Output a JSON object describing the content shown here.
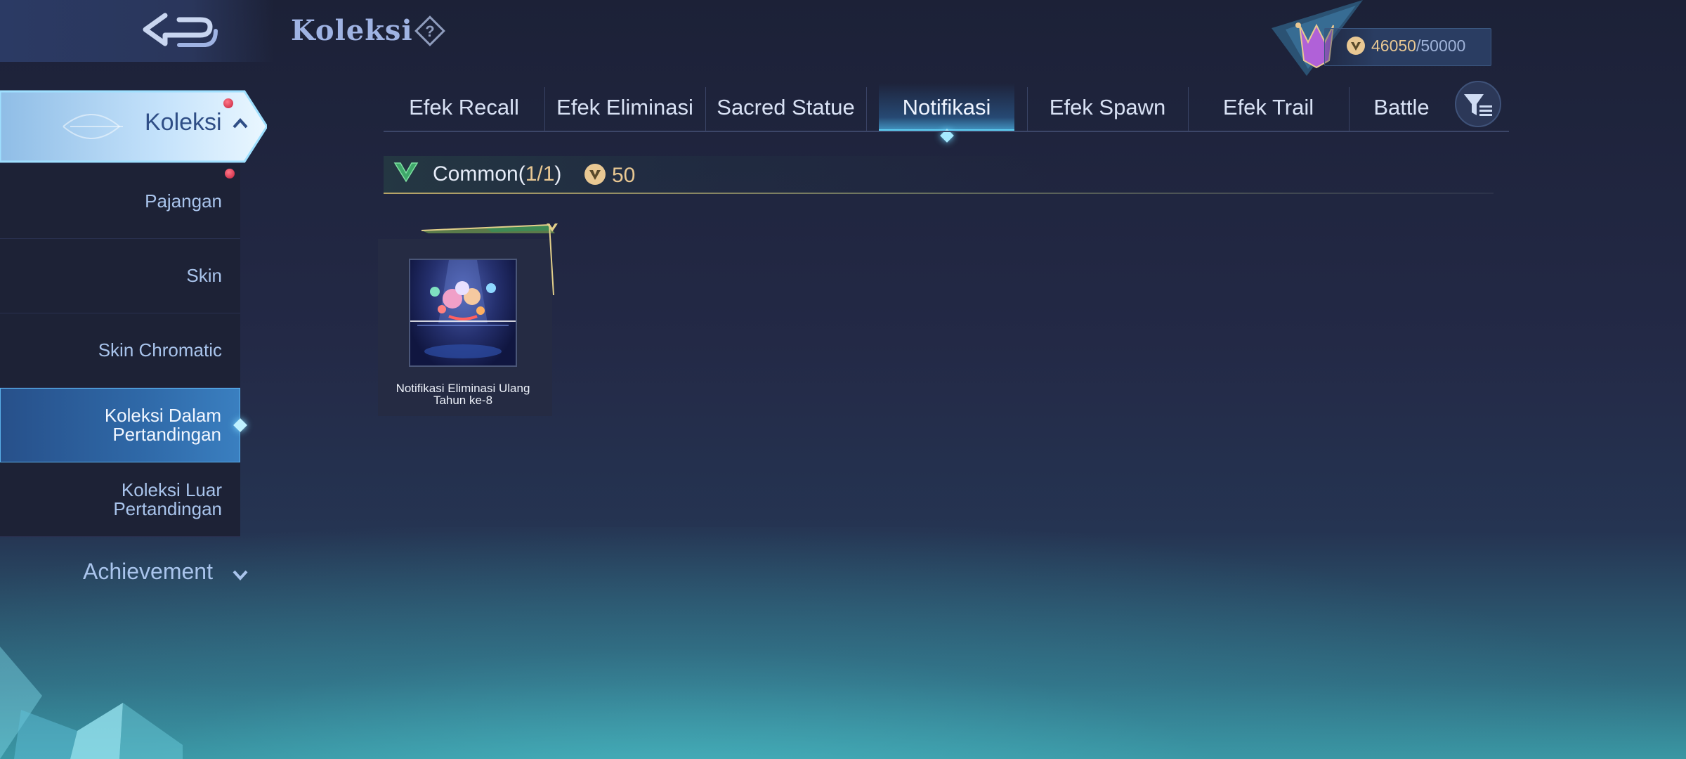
{
  "header": {
    "title": "Koleksi"
  },
  "points": {
    "current": "46050",
    "separator": "/",
    "max": "50000"
  },
  "sidebar": {
    "main_label": "Koleksi",
    "items": [
      {
        "label": "Pajangan"
      },
      {
        "label": "Skin"
      },
      {
        "label": "Skin Chromatic"
      },
      {
        "label": "Koleksi Dalam Pertandingan"
      },
      {
        "label": "Koleksi Luar Pertandingan"
      }
    ],
    "achievement_label": "Achievement"
  },
  "tabs": [
    {
      "label": "Efek Recall"
    },
    {
      "label": "Efek Eliminasi"
    },
    {
      "label": "Sacred Statue"
    },
    {
      "label": "Notifikasi"
    },
    {
      "label": "Efek Spawn"
    },
    {
      "label": "Efek Trail"
    },
    {
      "label": "Battle"
    }
  ],
  "rarity": {
    "label": "Common",
    "count_open": "(",
    "count": "1/1",
    "count_close": ")",
    "price": "50"
  },
  "items": [
    {
      "name": "Notifikasi Eliminasi Ulang Tahun ke-8"
    }
  ],
  "colors": {
    "accent": "#5fd0f5",
    "gold": "#e9c893",
    "text_blue": "#a9c4ec",
    "badge_red": "#c3203a"
  }
}
